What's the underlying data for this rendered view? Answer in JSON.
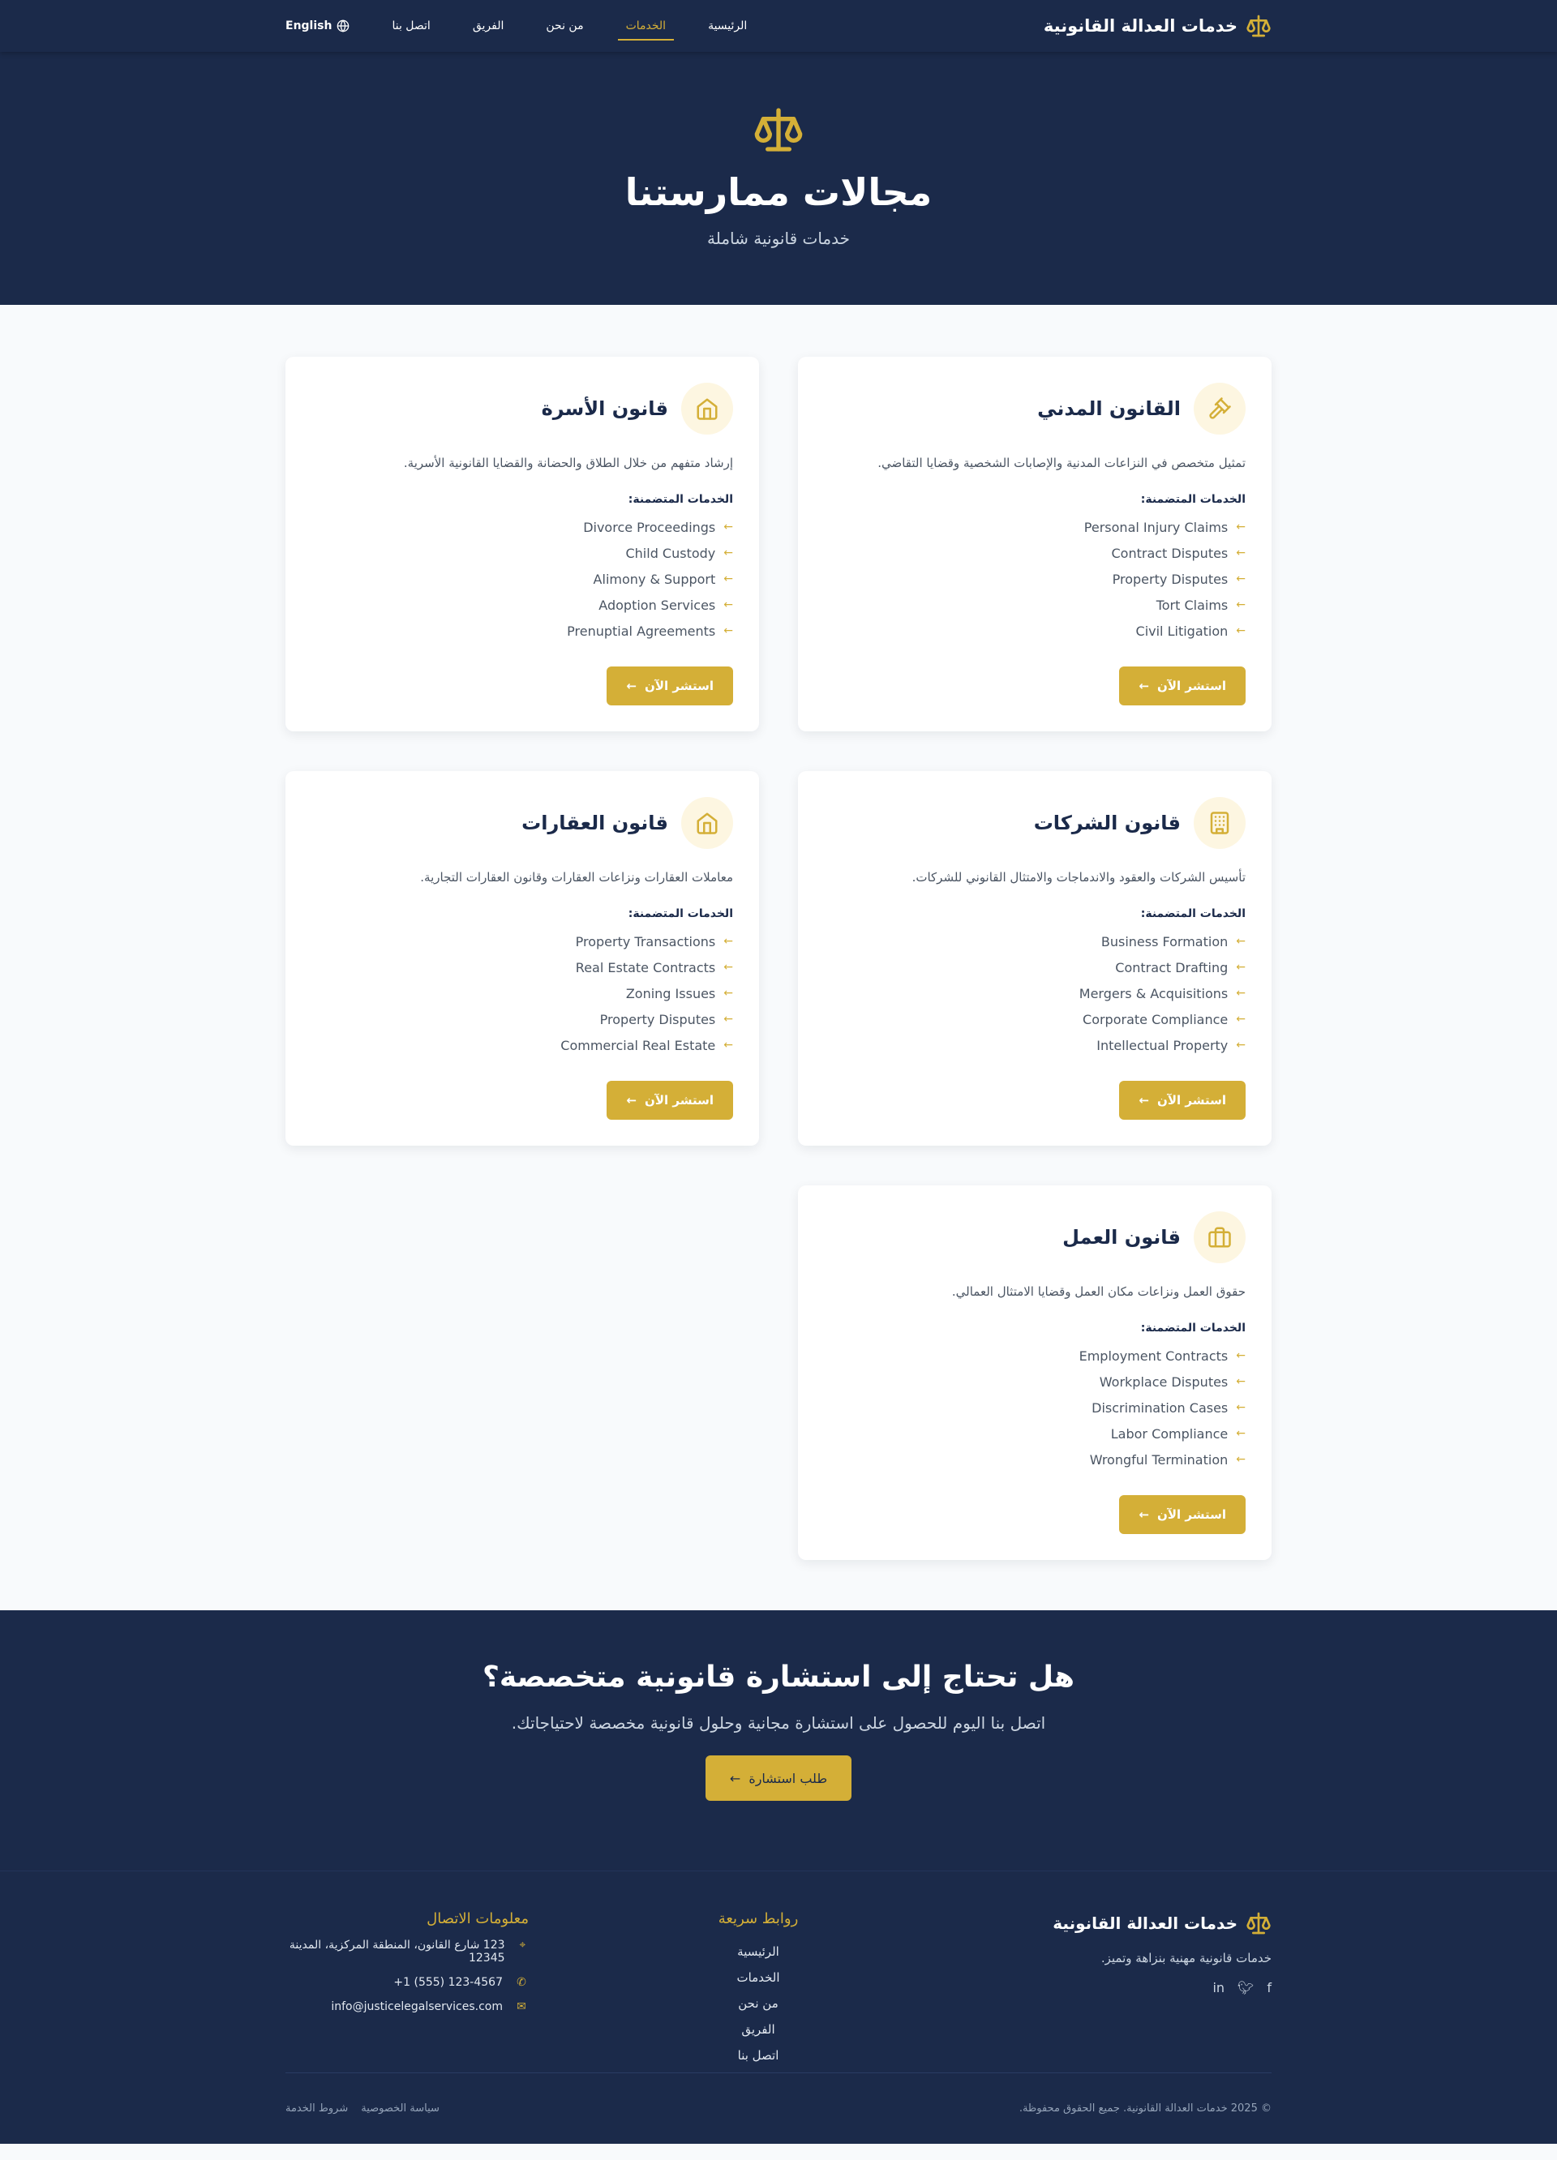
{
  "nav": {
    "brand": "خدمات العدالة القانونية",
    "links": [
      "الرئيسية",
      "الخدمات",
      "من نحن",
      "الفريق",
      "اتصل بنا"
    ],
    "active": "الخدمات",
    "lang": "English"
  },
  "hero": {
    "title": "مجالات ممارستنا",
    "subtitle": "خدمات قانونية شاملة"
  },
  "services": {
    "included_label": "الخدمات المتضمنة:",
    "cta_label": "استشر الآن",
    "cards": [
      {
        "title": "القانون المدني",
        "icon": "gavel-icon",
        "desc": "تمثيل متخصص في النزاعات المدنية والإصابات الشخصية وقضايا التقاضي.",
        "features": [
          "Personal Injury Claims",
          "Contract Disputes",
          "Property Disputes",
          "Tort Claims",
          "Civil Litigation"
        ]
      },
      {
        "title": "قانون الأسرة",
        "icon": "home-icon",
        "desc": "إرشاد متفهم من خلال الطلاق والحضانة والقضايا القانونية الأسرية.",
        "features": [
          "Divorce Proceedings",
          "Child Custody",
          "Alimony & Support",
          "Adoption Services",
          "Prenuptial Agreements"
        ]
      },
      {
        "title": "قانون الشركات",
        "icon": "building-icon",
        "desc": "تأسيس الشركات والعقود والاندماجات والامتثال القانوني للشركات.",
        "features": [
          "Business Formation",
          "Contract Drafting",
          "Mergers & Acquisitions",
          "Corporate Compliance",
          "Intellectual Property"
        ]
      },
      {
        "title": "قانون العقارات",
        "icon": "home-icon",
        "desc": "معاملات العقارات ونزاعات العقارات وقانون العقارات التجارية.",
        "features": [
          "Property Transactions",
          "Real Estate Contracts",
          "Zoning Issues",
          "Property Disputes",
          "Commercial Real Estate"
        ]
      },
      {
        "title": "قانون العمل",
        "icon": "briefcase-icon",
        "desc": "حقوق العمل ونزاعات مكان العمل وقضايا الامتثال العمالي.",
        "features": [
          "Employment Contracts",
          "Workplace Disputes",
          "Discrimination Cases",
          "Labor Compliance",
          "Wrongful Termination"
        ]
      }
    ]
  },
  "cta": {
    "title": "هل تحتاج إلى استشارة قانونية متخصصة؟",
    "subtitle": "اتصل بنا اليوم للحصول على استشارة مجانية وحلول قانونية مخصصة لاحتياجاتك.",
    "button": "طلب استشارة"
  },
  "footer": {
    "brand": "خدمات العدالة القانونية",
    "tagline": "خدمات قانونية مهنية بنزاهة وتميز.",
    "quick_links_title": "روابط سريعة",
    "quick_links": [
      "الرئيسية",
      "الخدمات",
      "من نحن",
      "الفريق",
      "اتصل بنا"
    ],
    "contact_title": "معلومات الاتصال",
    "address": "123 شارع القانون، المنطقة المركزية، المدينة 12345",
    "phone": "+1 (555) 123-4567",
    "email": "info@justicelegalservices.com",
    "copyright": "© 2025 خدمات العدالة القانونية. جميع الحقوق محفوظة.",
    "privacy": "سياسة الخصوصية",
    "terms": "شروط الخدمة"
  },
  "colors": {
    "navy": "#1b2a4a",
    "gold": "#d4af37"
  }
}
